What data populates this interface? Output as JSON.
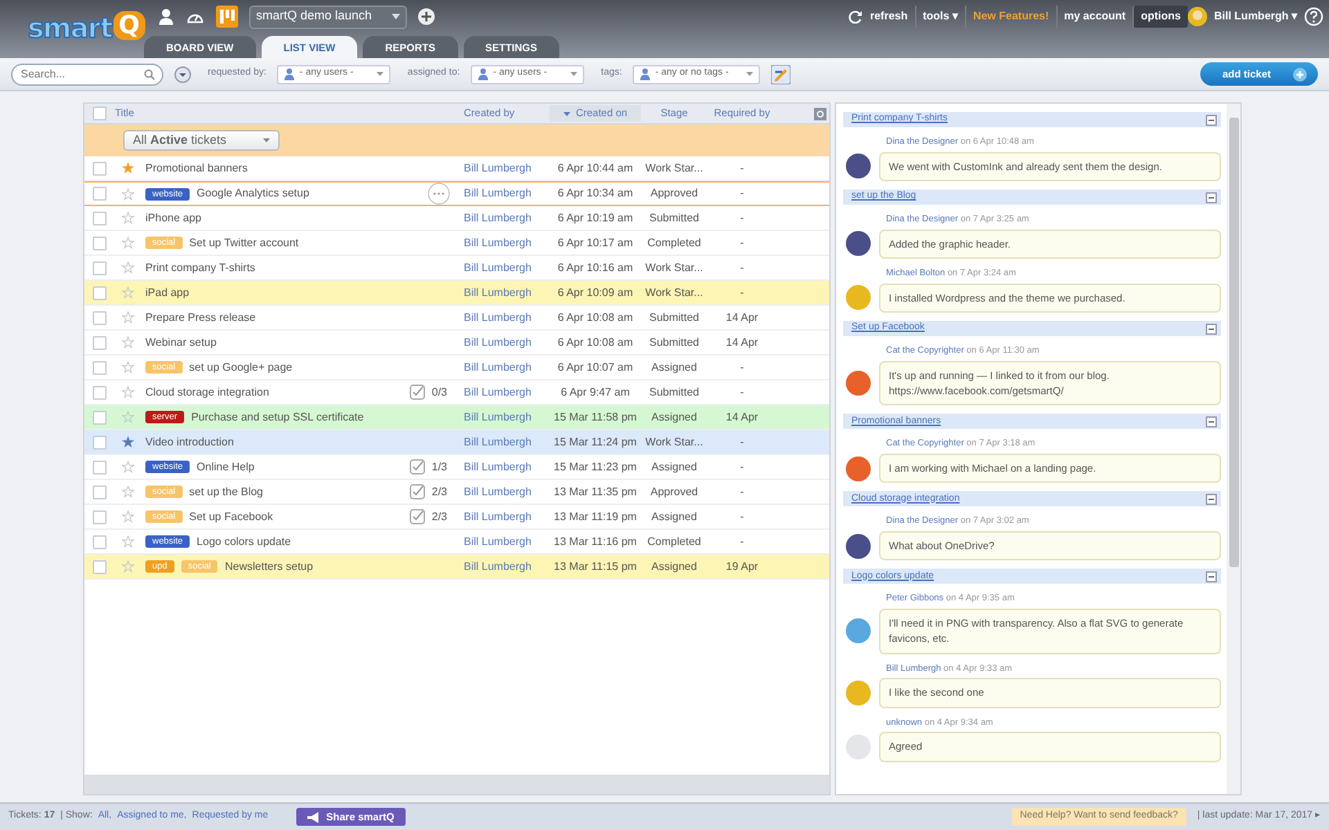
{
  "header": {
    "logo": {
      "word": "smart",
      "letter": "Q"
    },
    "project": "smartQ demo launch",
    "links": [
      {
        "kind": "refresh",
        "label": "refresh"
      },
      {
        "kind": "menu",
        "label": "tools ▾"
      },
      {
        "kind": "new",
        "label": "New Features!"
      },
      {
        "kind": "plain",
        "label": "my account"
      },
      {
        "kind": "selected",
        "label": "options"
      }
    ],
    "user": "Bill Lumbergh ▾"
  },
  "tabs": [
    {
      "label": "BOARD VIEW",
      "selected": false
    },
    {
      "label": "LIST VIEW",
      "selected": true
    },
    {
      "label": "REPORTS",
      "selected": false
    },
    {
      "label": "SETTINGS",
      "selected": false
    }
  ],
  "filters": {
    "search": {
      "placeholder": "Search..."
    },
    "selects": [
      {
        "label": "requested by:",
        "value": "- any users -"
      },
      {
        "label": "assigned to:",
        "value": "- any users -"
      },
      {
        "label": "tags:",
        "value": "- any or no tags -"
      }
    ],
    "add_button": "add ticket"
  },
  "table": {
    "select_all_checked": false,
    "columns": [
      {
        "label": "Title",
        "sorted": false
      },
      {
        "label": "Created by",
        "sorted": false
      },
      {
        "label": "Created on",
        "sorted": true
      },
      {
        "label": "Stage",
        "sorted": false
      },
      {
        "label": "Required by",
        "sorted": false
      }
    ],
    "view": "All **Active** tickets",
    "rows": [
      {
        "title": "Promotional banners",
        "checked": false,
        "starred": true,
        "selected": false,
        "color": "#ffffff",
        "tags": [],
        "created_by": "Bill Lumbergh",
        "created_on": "6 Apr 10:44 am",
        "stage": "Work Star...",
        "required_by": "-"
      },
      {
        "title": "Google Analytics setup",
        "checked": false,
        "starred": false,
        "selected": true,
        "color": "#ffffff",
        "tags": [
          {
            "label": "website",
            "color": "#3a62c4"
          }
        ],
        "created_by": "Bill Lumbergh",
        "created_on": "6 Apr 10:34 am",
        "stage": "Approved",
        "required_by": "-"
      },
      {
        "title": "iPhone app",
        "checked": false,
        "starred": false,
        "selected": false,
        "color": "#ffffff",
        "tags": [],
        "created_by": "Bill Lumbergh",
        "created_on": "6 Apr 10:19 am",
        "stage": "Submitted",
        "required_by": "-"
      },
      {
        "title": "Set up Twitter account",
        "checked": false,
        "starred": false,
        "selected": false,
        "color": "#ffffff",
        "tags": [
          {
            "label": "social",
            "color": "#f7c46a"
          }
        ],
        "created_by": "Bill Lumbergh",
        "created_on": "6 Apr 10:17 am",
        "stage": "Completed",
        "required_by": "-"
      },
      {
        "title": "Print company T-shirts",
        "checked": false,
        "starred": false,
        "selected": false,
        "color": "#ffffff",
        "tags": [],
        "created_by": "Bill Lumbergh",
        "created_on": "6 Apr 10:16 am",
        "stage": "Work Star...",
        "required_by": "-"
      },
      {
        "title": "iPad app",
        "checked": false,
        "starred": false,
        "selected": false,
        "color": "#fdf5b4",
        "tags": [],
        "created_by": "Bill Lumbergh",
        "created_on": "6 Apr 10:09 am",
        "stage": "Work Star...",
        "required_by": "-"
      },
      {
        "title": "Prepare Press release",
        "checked": false,
        "starred": false,
        "selected": false,
        "color": "#ffffff",
        "tags": [],
        "created_by": "Bill Lumbergh",
        "created_on": "6 Apr 10:08 am",
        "stage": "Submitted",
        "required_by": "14 Apr"
      },
      {
        "title": "Webinar setup",
        "checked": false,
        "starred": false,
        "selected": false,
        "color": "#ffffff",
        "tags": [],
        "created_by": "Bill Lumbergh",
        "created_on": "6 Apr 10:08 am",
        "stage": "Submitted",
        "required_by": "14 Apr"
      },
      {
        "title": "set up Google+ page",
        "checked": false,
        "starred": false,
        "selected": false,
        "color": "#ffffff",
        "tags": [
          {
            "label": "social",
            "color": "#f7c46a"
          }
        ],
        "created_by": "Bill Lumbergh",
        "created_on": "6 Apr 10:07 am",
        "stage": "Assigned",
        "required_by": "-"
      },
      {
        "title": "Cloud storage integration",
        "checked": false,
        "starred": false,
        "selected": false,
        "color": "#ffffff",
        "tags": [],
        "checklist": "0/3",
        "created_by": "Bill Lumbergh",
        "created_on": "6 Apr 9:47 am",
        "stage": "Submitted",
        "required_by": "-"
      },
      {
        "title": "Purchase and setup SSL certificate",
        "checked": false,
        "starred": false,
        "selected": false,
        "color": "#d5f8d2",
        "tags": [
          {
            "label": "server",
            "color": "#c01818"
          }
        ],
        "created_by": "Bill Lumbergh",
        "created_on": "15 Mar 11:58 pm",
        "stage": "Assigned",
        "required_by": "14 Apr"
      },
      {
        "title": "Video introduction",
        "checked": false,
        "starred": true,
        "selected": false,
        "color": "#dce9fa",
        "tags": [],
        "created_by": "Bill Lumbergh",
        "created_on": "15 Mar 11:24 pm",
        "stage": "Work Star...",
        "required_by": "-"
      },
      {
        "title": "Online Help",
        "checked": false,
        "starred": false,
        "selected": false,
        "color": "#ffffff",
        "tags": [
          {
            "label": "website",
            "color": "#3a62c4"
          }
        ],
        "checklist": "1/3",
        "created_by": "Bill Lumbergh",
        "created_on": "15 Mar 11:23 pm",
        "stage": "Assigned",
        "required_by": "-"
      },
      {
        "title": "set up the Blog",
        "checked": false,
        "starred": false,
        "selected": false,
        "color": "#ffffff",
        "tags": [
          {
            "label": "social",
            "color": "#f7c46a"
          }
        ],
        "checklist": "2/3",
        "created_by": "Bill Lumbergh",
        "created_on": "13 Mar 11:35 pm",
        "stage": "Approved",
        "required_by": "-"
      },
      {
        "title": "Set up Facebook",
        "checked": false,
        "starred": false,
        "selected": false,
        "color": "#ffffff",
        "tags": [
          {
            "label": "social",
            "color": "#f7c46a"
          }
        ],
        "checklist": "2/3",
        "created_by": "Bill Lumbergh",
        "created_on": "13 Mar 11:19 pm",
        "stage": "Assigned",
        "required_by": "-"
      },
      {
        "title": "Logo colors update",
        "checked": false,
        "starred": false,
        "selected": false,
        "color": "#ffffff",
        "tags": [
          {
            "label": "website",
            "color": "#3a62c4"
          }
        ],
        "created_by": "Bill Lumbergh",
        "created_on": "13 Mar 11:16 pm",
        "stage": "Completed",
        "required_by": "-"
      },
      {
        "title": "Newsletters setup",
        "checked": false,
        "starred": false,
        "selected": false,
        "color": "#fdf5b4",
        "tags": [
          {
            "label": "upd",
            "color": "#f0a020"
          },
          {
            "label": "social",
            "color": "#f7c46a"
          }
        ],
        "created_by": "Bill Lumbergh",
        "created_on": "13 Mar 11:15 pm",
        "stage": "Assigned",
        "required_by": "19 Apr"
      }
    ]
  },
  "comments": [
    {
      "ticket": "Print company T-shirts",
      "items": [
        {
          "author": "Dina the Designer",
          "time": "on 6 Apr 10:48 am",
          "color": "#4a4f8a",
          "text": "We went with CustomInk and already sent them the design."
        }
      ]
    },
    {
      "ticket": "set up the Blog",
      "items": [
        {
          "author": "Dina the Designer",
          "time": "on 7 Apr 3:25 am",
          "color": "#4a4f8a",
          "text": "Added the graphic header."
        },
        {
          "author": "Michael Bolton",
          "time": "on 7 Apr 3:24 am",
          "color": "#e8b820",
          "text": "I installed Wordpress and the theme we purchased."
        }
      ]
    },
    {
      "ticket": "Set up Facebook",
      "items": [
        {
          "author": "Cat the Copyrighter",
          "time": "on 6 Apr 11:30 am",
          "color": "#e8602a",
          "text": "It's up and running — I linked to it from our blog.",
          "link": "https://www.facebook.com/getsmartQ/"
        }
      ]
    },
    {
      "ticket": "Promotional banners",
      "items": [
        {
          "author": "Cat the Copyrighter",
          "time": "on 7 Apr 3:18 am",
          "color": "#e8602a",
          "text": "I am working with Michael on a landing page."
        }
      ]
    },
    {
      "ticket": "Cloud storage integration",
      "items": [
        {
          "author": "Dina the Designer",
          "time": "on 7 Apr 3:02 am",
          "color": "#4a4f8a",
          "text": "What about OneDrive?"
        }
      ]
    },
    {
      "ticket": "Logo colors update",
      "items": [
        {
          "author": "Peter Gibbons",
          "time": "on 4 Apr 9:35 am",
          "color": "#5aa8e0",
          "text": "I'll need it in PNG with transparency. Also a flat SVG to generate favicons, etc."
        },
        {
          "author": "Bill Lumbergh",
          "time": "on 4 Apr 9:33 am",
          "color": "#e8b820",
          "text": "I like the second one"
        },
        {
          "author": "unknown",
          "time": "on 4 Apr 9:34 am",
          "color": "#e4e6ea",
          "text": "Agreed"
        }
      ]
    }
  ],
  "status_bar": {
    "count_label": "Tickets:",
    "count": "17",
    "show_label": "| Show:",
    "show_links": [
      "All,",
      "Assigned to me,",
      "Requested by me"
    ],
    "share": "Share smartQ",
    "help": "Need Help? Want to send feedback?",
    "update": "| last update: Mar 17, 2017 ▸"
  }
}
